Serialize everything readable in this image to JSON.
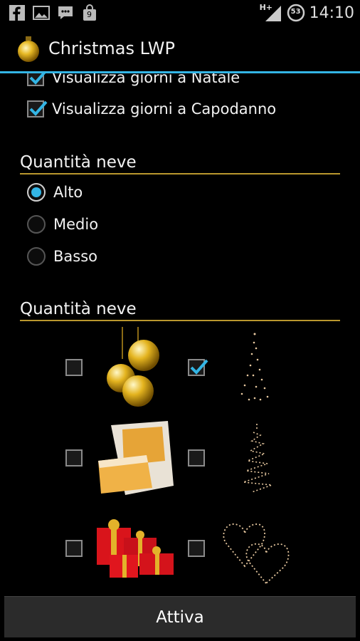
{
  "statusbar": {
    "icons": [
      "facebook-icon",
      "image-icon",
      "bbm-chat-icon",
      "shopping-bag-icon"
    ],
    "bag_badge": "9",
    "network": "H+",
    "battery": "53",
    "time": "14:10"
  },
  "actionbar": {
    "title": "Christmas LWP",
    "icon": "ornament-icon"
  },
  "checkboxes": [
    {
      "label": "Visualizza giorni a Natale",
      "checked": true
    },
    {
      "label": "Visualizza giorni a Capodanno",
      "checked": true
    }
  ],
  "snow_section": {
    "title": "Quantità neve",
    "options": [
      {
        "label": "Alto",
        "selected": true
      },
      {
        "label": "Medio",
        "selected": false
      },
      {
        "label": "Basso",
        "selected": false
      }
    ]
  },
  "images_section": {
    "title": "Quantità neve",
    "items": [
      {
        "name": "ornament-balls-image",
        "checked": false
      },
      {
        "name": "light-tree-image",
        "checked": true
      },
      {
        "name": "pandoro-cake-image",
        "checked": false
      },
      {
        "name": "spiral-tree-image",
        "checked": false
      },
      {
        "name": "gift-boxes-image",
        "checked": false
      },
      {
        "name": "light-hearts-image",
        "checked": false
      }
    ]
  },
  "bottom": {
    "button_label": "Attiva"
  },
  "colors": {
    "accent": "#33b5e5",
    "divider": "#b9972e"
  }
}
